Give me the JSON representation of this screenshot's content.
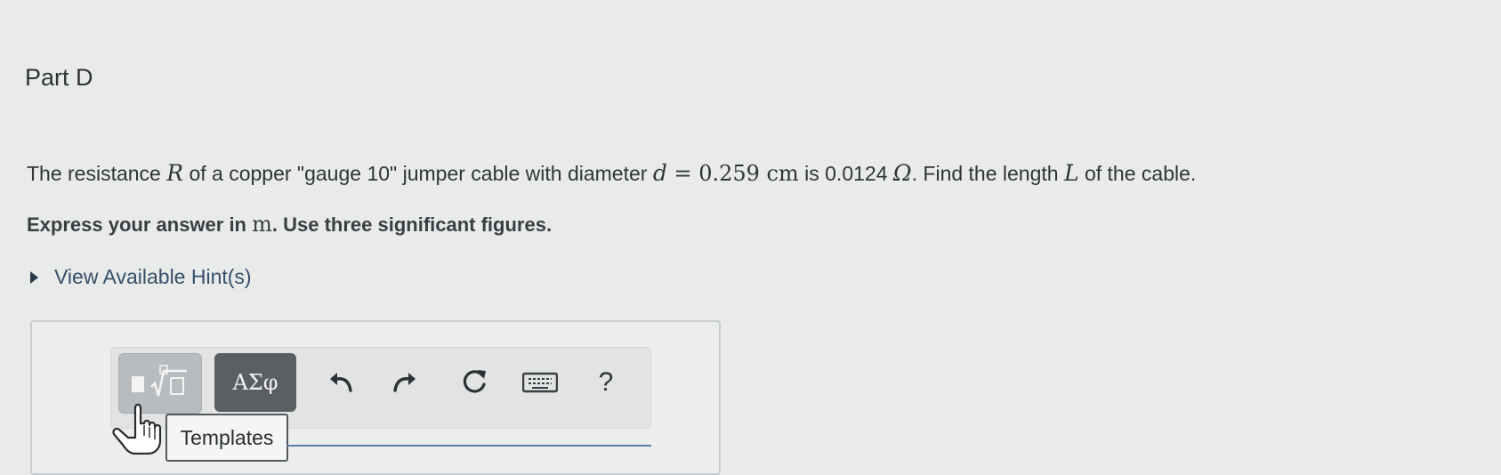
{
  "part": {
    "title": "Part D"
  },
  "problem": {
    "t1": "The resistance ",
    "v_R": "R",
    "t2": " of a copper \"gauge 10\" jumper cable with diameter ",
    "v_d": "d",
    "eq": " = 0.259 ",
    "unit_cm": "cm",
    "t3": " is 0.0124 ",
    "unit_ohm": "Ω",
    "t4": ". Find the length ",
    "v_L": "L",
    "t5": " of the cable."
  },
  "instructions": {
    "t1": "Express your answer in ",
    "unit_m": "m",
    "t2": ". Use three significant figures."
  },
  "hint": {
    "label": "View Available Hint(s)"
  },
  "toolbar": {
    "greek_label": "ΑΣφ",
    "help_label": "?",
    "tooltip": "Templates"
  },
  "icons": [
    "templates-icon",
    "undo-icon",
    "redo-icon",
    "reset-icon",
    "keyboard-icon",
    "hand-cursor-icon"
  ],
  "colors": {
    "hint_link": "#35506a",
    "greek_button": "#5b5f63",
    "input_border": "#5b7fa8"
  }
}
